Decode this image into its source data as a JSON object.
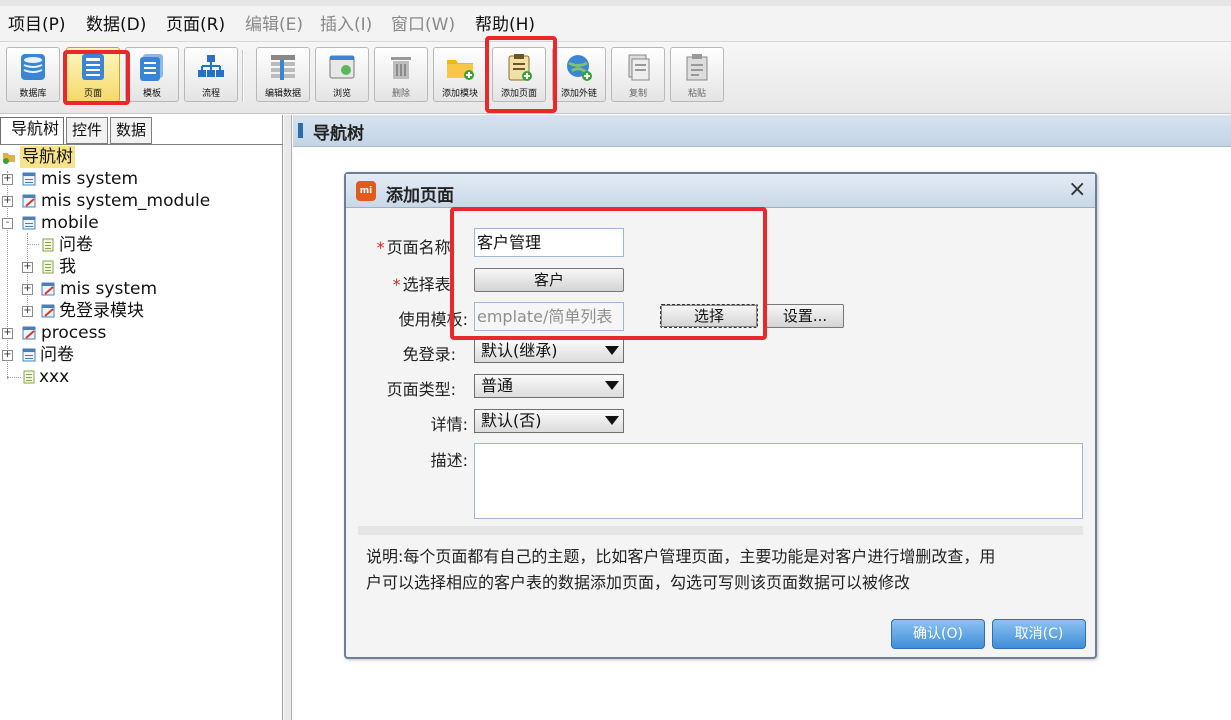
{
  "menu": [
    {
      "label": "项目(P)",
      "enabled": true
    },
    {
      "label": "数据(D)",
      "enabled": true
    },
    {
      "label": "页面(R)",
      "enabled": true
    },
    {
      "label": "编辑(E)",
      "enabled": false
    },
    {
      "label": "插入(I)",
      "enabled": false
    },
    {
      "label": "窗口(W)",
      "enabled": false
    },
    {
      "label": "帮助(H)",
      "enabled": true
    }
  ],
  "toolbar": [
    {
      "label": "数据库",
      "icon": "database-icon"
    },
    {
      "label": "页面",
      "icon": "page-icon",
      "active": true
    },
    {
      "label": "模板",
      "icon": "template-icon"
    },
    {
      "label": "流程",
      "icon": "flow-icon"
    },
    {
      "label": "编辑数据",
      "icon": "edit-data-icon"
    },
    {
      "label": "浏览",
      "icon": "browse-icon"
    },
    {
      "label": "删除",
      "icon": "trash-icon",
      "disabled": true
    },
    {
      "label": "添加模块",
      "icon": "folder-add-icon"
    },
    {
      "label": "添加页面",
      "icon": "clipboard-add-icon"
    },
    {
      "label": "添加外链",
      "icon": "globe-link-icon"
    },
    {
      "label": "复制",
      "icon": "copy-icon",
      "disabled": true
    },
    {
      "label": "粘贴",
      "icon": "paste-icon",
      "disabled": true
    }
  ],
  "left": {
    "tabs": [
      "导航树",
      "控件",
      "数据"
    ],
    "tree": [
      {
        "label": "导航树",
        "level": 0,
        "type": "root",
        "expander": ""
      },
      {
        "label": "mis system",
        "level": 0,
        "type": "module",
        "expander": "+"
      },
      {
        "label": "mis system_module",
        "level": 0,
        "type": "edit",
        "expander": "+"
      },
      {
        "label": "mobile",
        "level": 0,
        "type": "module",
        "expander": "-"
      },
      {
        "label": "问卷",
        "level": 1,
        "type": "page",
        "expander": ""
      },
      {
        "label": "我",
        "level": 1,
        "type": "page",
        "expander": "+"
      },
      {
        "label": "mis system",
        "level": 1,
        "type": "edit",
        "expander": "+"
      },
      {
        "label": "免登录模块",
        "level": 1,
        "type": "edit",
        "expander": "+"
      },
      {
        "label": "process",
        "level": 0,
        "type": "edit",
        "expander": "+"
      },
      {
        "label": "问卷",
        "level": 0,
        "type": "module",
        "expander": "+"
      },
      {
        "label": "xxx",
        "level": 0,
        "type": "page",
        "expander": ""
      }
    ]
  },
  "right": {
    "title": "导航树"
  },
  "dialog": {
    "title": "添加页面",
    "logo": "mi",
    "close": "×",
    "fields": {
      "page_name_label": "页面名称:",
      "page_name_value": "客户管理",
      "select_table_label": "选择表:",
      "select_table_value": "客户",
      "template_label": "使用模板:",
      "template_value": "emplate/简单列表",
      "choose_button": "选择",
      "settings_button": "设置...",
      "no_login_label": "免登录:",
      "no_login_value": "默认(继承)",
      "page_type_label": "页面类型:",
      "page_type_value": "普通",
      "detail_label": "详情:",
      "detail_value": "默认(否)",
      "desc_label": "描述:"
    },
    "note_line1": "说明:每个页面都有自己的主题，比如客户管理页面，主要功能是对客户进行增删改查，用",
    "note_line2": "户可以选择相应的客户表的数据添加页面，勾选可写则该页面数据可以被修改",
    "ok_button": "确认(O)",
    "cancel_button": "取消(C)"
  },
  "colors": {
    "highlight": "#e8282a",
    "header_blue": "#c9d8e7",
    "button_blue": "#3f8ed8",
    "required_star": "#d22222"
  }
}
